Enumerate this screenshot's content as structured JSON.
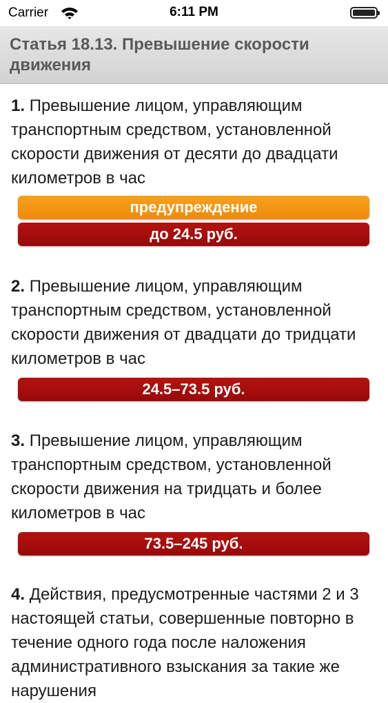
{
  "status_bar": {
    "carrier": "Carrier",
    "time": "6:11 PM"
  },
  "header": {
    "title": "Статья 18.13. Превышение скорости движения"
  },
  "items": [
    {
      "number": "1.",
      "text": "Превышение лицом, управляющим транспортным средством, установленной скорости движения от десяти до двадцати километров в час",
      "penalties": [
        "предупреждение",
        "до 24.5 руб."
      ]
    },
    {
      "number": "2.",
      "text": "Превышение лицом, управляющим транспортным средством, установленной скорости движения от двадцати до тридцати километров в час",
      "penalties": [
        "24.5–73.5 руб."
      ]
    },
    {
      "number": "3.",
      "text": "Превышение лицом, управляющим транспортным средством, установленной скорости движения на тридцать и более километров в час",
      "penalties": [
        "73.5–245 руб."
      ]
    },
    {
      "number": "4.",
      "text": "Действия, предусмотренные частями 2 и 3 настоящей статьи, совершенные повторно в течение одного года после наложения административного взыскания за такие же нарушения"
    }
  ],
  "colors": {
    "warning": "#f39414",
    "fine": "#a50e0c",
    "header_text": "#595959"
  }
}
